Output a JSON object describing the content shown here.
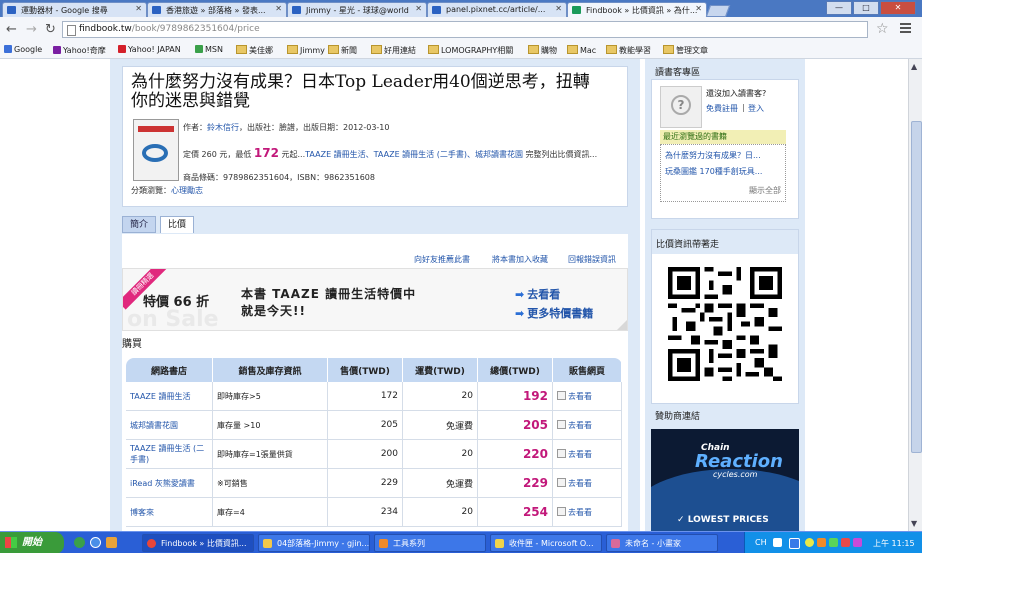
{
  "tabs": [
    {
      "label": "運動器材 - Google 搜尋",
      "active": false
    },
    {
      "label": "香港旅遊 » 部落格 » 發表...",
      "active": false
    },
    {
      "label": "Jimmy - 星光 - 球球@world",
      "active": false
    },
    {
      "label": "panel.pixnet.cc/article/...",
      "active": false
    },
    {
      "label": "Findbook » 比價資訊 » 為什...",
      "active": true
    }
  ],
  "window_controls": [
    "—",
    "□",
    "✕"
  ],
  "url": {
    "host": "findbook.tw",
    "path": "/book/9789862351604/price"
  },
  "bookmarks": [
    "Google",
    "Yahoo!奇摩",
    "Yahoo! JAPAN",
    "MSN",
    "美佳娜",
    "Jimmy",
    "新聞",
    "好用連結",
    "LOMOGRAPHY相關",
    "購物",
    "Mac",
    "教能學習",
    "管理文章"
  ],
  "book": {
    "title": "為什麼努力沒有成果？日本Top Leader用40個逆思考，扭轉你的迷思與錯覺",
    "author_line_prefix": "作者：",
    "author": "鈴木信行",
    "publisher_line": "，出版社：臉譜，出版日期：2012-03-10",
    "list_price_prefix": "定價 260 元，最低",
    "best_price": "172",
    "price_suffix": "元起...",
    "store_links": "TAAZE 讀冊生活、TAAZE 讀冊生活 (二手書)、城邦讀書花園",
    "more_text": "完整列出比價資訊...",
    "isbn_line": "商品條碼：9789862351604，ISBN：9862351608",
    "category_label": "分類瀏覽：",
    "category": "心理勵志"
  },
  "subtabs": [
    "簡介",
    "比價"
  ],
  "top_links": [
    "向好友推薦此書",
    "將本書加入收藏",
    "回報錯誤資訊"
  ],
  "promo": {
    "ribbon": "讀冊精選",
    "discount": "特價 66 折",
    "bg_text": "on Sale",
    "line1": "本書 TAAZE 讀冊生活特價中",
    "line2": "就是今天!!",
    "link1": "去看看",
    "link2": "更多特價書籍"
  },
  "section_title": "購買",
  "table": {
    "headers": [
      "網路書店",
      "銷售及庫存資訊",
      "售價(TWD)",
      "運費(TWD)",
      "總價(TWD)",
      "販售網頁"
    ],
    "rows": [
      {
        "store": "TAAZE 讀冊生活",
        "stock": "即時庫存>5",
        "price": "172",
        "ship": "20",
        "total": "192",
        "link": "去看看"
      },
      {
        "store": "城邦讀書花園",
        "stock": "庫存量 >10",
        "price": "205",
        "ship": "免運費",
        "total": "205",
        "link": "去看看"
      },
      {
        "store": "TAAZE 讀冊生活 (二手書)",
        "stock": "即時庫存=1張量供貨",
        "price": "200",
        "ship": "20",
        "total": "220",
        "link": "去看看"
      },
      {
        "store": "iRead 灰熊愛讀書",
        "stock": "※可銷售",
        "price": "229",
        "ship": "免運費",
        "total": "229",
        "link": "去看看"
      },
      {
        "store": "博客來",
        "stock": "庫存=4",
        "price": "234",
        "ship": "20",
        "total": "254",
        "link": "去看看"
      }
    ]
  },
  "side": {
    "member_title": "讀書客專區",
    "join_question": "還沒加入讀書客?",
    "signup": "免費註冊",
    "login": "登入",
    "recent_title": "最近瀏覽過的書籍",
    "recent_items": [
      "為什麼努力沒有成果？日...",
      "玩桑圖鑑 170種手創玩具..."
    ],
    "show_all": "顯示全部",
    "mobile_title": "比價資訊帶著走",
    "sponsor_title": "贊助商連結",
    "sponsor_ad": {
      "line1": "Chain",
      "line2": "Reaction",
      "line3": "cycles.com",
      "line4": "LOWEST PRICES"
    }
  },
  "taskbar": {
    "start": "開始",
    "items": [
      "Findbook » 比價資訊...",
      "04部落格-Jimmy - gjin...",
      "工具系列",
      "收件匣 - Microsoft O...",
      "未命名 - 小畫家"
    ],
    "lang": "CH",
    "clock": "上午 11:15"
  }
}
